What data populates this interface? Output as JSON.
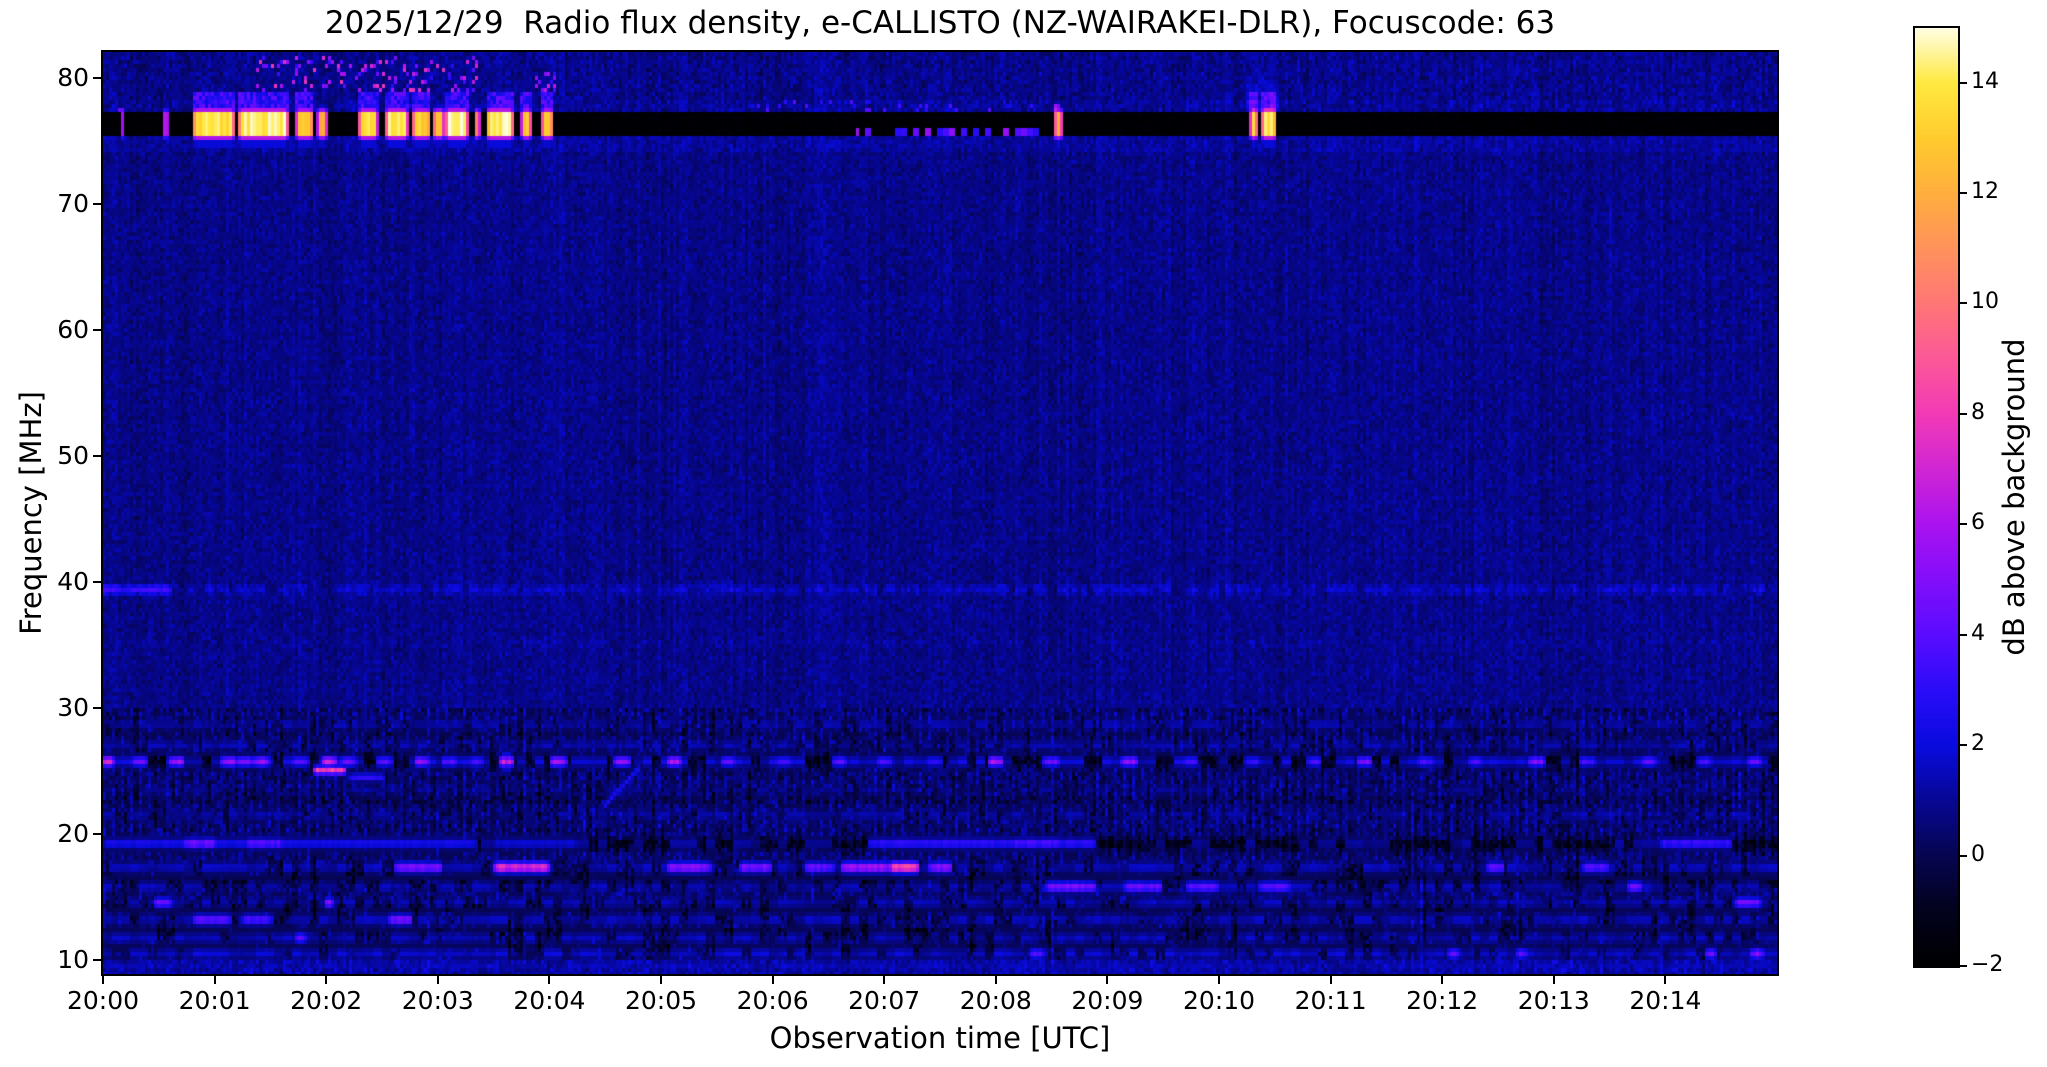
{
  "chart_data": {
    "type": "heatmap",
    "subtype": "radio-spectrogram",
    "title": "2025/12/29  Radio flux density, e-CALLISTO (NZ-WAIRAKEI-DLR), Focuscode: 63",
    "date": "2025/12/29",
    "instrument": "e-CALLISTO (NZ-WAIRAKEI-DLR)",
    "focuscode": "63",
    "xlabel": "Observation time [UTC]",
    "ylabel": "Frequency [MHz]",
    "x_range_minutes": [
      0,
      15
    ],
    "x_start_time": "20:00",
    "y_range_mhz": [
      8.9,
      82.1
    ],
    "grid": false,
    "x_ticks": [
      {
        "t": 0,
        "label": "20:00"
      },
      {
        "t": 1,
        "label": "20:01"
      },
      {
        "t": 2,
        "label": "20:02"
      },
      {
        "t": 3,
        "label": "20:03"
      },
      {
        "t": 4,
        "label": "20:04"
      },
      {
        "t": 5,
        "label": "20:05"
      },
      {
        "t": 6,
        "label": "20:06"
      },
      {
        "t": 7,
        "label": "20:07"
      },
      {
        "t": 8,
        "label": "20:08"
      },
      {
        "t": 9,
        "label": "20:09"
      },
      {
        "t": 10,
        "label": "20:10"
      },
      {
        "t": 11,
        "label": "20:11"
      },
      {
        "t": 12,
        "label": "20:12"
      },
      {
        "t": 13,
        "label": "20:13"
      },
      {
        "t": 14,
        "label": "20:14"
      }
    ],
    "y_ticks": [
      {
        "f": 80,
        "label": "80"
      },
      {
        "f": 70,
        "label": "70"
      },
      {
        "f": 60,
        "label": "60"
      },
      {
        "f": 50,
        "label": "50"
      },
      {
        "f": 40,
        "label": "40"
      },
      {
        "f": 30,
        "label": "30"
      },
      {
        "f": 20,
        "label": "20"
      },
      {
        "f": 10,
        "label": "10"
      }
    ],
    "colorbar": {
      "label": "dB above background",
      "range": [
        -2,
        14.99
      ],
      "ticks": [
        {
          "v": 14,
          "label": "14"
        },
        {
          "v": 12,
          "label": "12"
        },
        {
          "v": 10,
          "label": "10"
        },
        {
          "v": 8,
          "label": "8"
        },
        {
          "v": 6,
          "label": "6"
        },
        {
          "v": 4,
          "label": "4"
        },
        {
          "v": 2,
          "label": "2"
        },
        {
          "v": 0,
          "label": "0"
        },
        {
          "v": -2,
          "label": "−2"
        }
      ]
    },
    "colormap_stops": [
      [
        -2,
        0,
        0,
        0
      ],
      [
        -1,
        2,
        2,
        28
      ],
      [
        0,
        6,
        5,
        80
      ],
      [
        1,
        7,
        7,
        148
      ],
      [
        2,
        9,
        11,
        222
      ],
      [
        3,
        42,
        12,
        248
      ],
      [
        4,
        90,
        12,
        255
      ],
      [
        5,
        130,
        14,
        250
      ],
      [
        6,
        170,
        18,
        240
      ],
      [
        7,
        208,
        38,
        212
      ],
      [
        8,
        242,
        58,
        182
      ],
      [
        9,
        252,
        88,
        152
      ],
      [
        10,
        255,
        118,
        118
      ],
      [
        11,
        255,
        146,
        92
      ],
      [
        12,
        255,
        174,
        62
      ],
      [
        13,
        255,
        203,
        46
      ],
      [
        14,
        255,
        233,
        64
      ],
      [
        15.05,
        255,
        255,
        236
      ]
    ],
    "features": {
      "band": {
        "f0": 75.25,
        "f1": 77.25,
        "value_db": -2
      },
      "band_bursts": [
        [
          0.155,
          0.185,
          9
        ],
        [
          0.54,
          0.585,
          10
        ],
        [
          0.8,
          1.18,
          14.5
        ],
        [
          1.21,
          1.66,
          15
        ],
        [
          1.73,
          1.89,
          14
        ],
        [
          1.92,
          2.01,
          12.5
        ],
        [
          2.29,
          2.46,
          14.5
        ],
        [
          2.53,
          2.73,
          15
        ],
        [
          2.77,
          2.94,
          14
        ],
        [
          2.955,
          3.06,
          13
        ],
        [
          3.07,
          3.27,
          15
        ],
        [
          3.32,
          3.38,
          12
        ],
        [
          3.43,
          3.68,
          15
        ],
        [
          3.75,
          3.84,
          13.5
        ],
        [
          3.93,
          4.04,
          14
        ],
        [
          8.52,
          8.6,
          13
        ],
        [
          10.28,
          10.35,
          14.5
        ],
        [
          10.38,
          10.52,
          15
        ]
      ],
      "band_dashes": [
        [
          6.75,
          6.95,
          0.3
        ],
        [
          7.05,
          8.5,
          0.55
        ]
      ],
      "spikes": [
        [
          0.165,
          77.25,
          77.65,
          6
        ],
        [
          8.556,
          77.25,
          77.95,
          7
        ]
      ],
      "halo": [
        10.25,
        10.55
      ],
      "speckle_clusters": [
        {
          "t0": 1.33,
          "t1": 3.35,
          "f0": 78.8,
          "f1": 81.7,
          "p": 0.16,
          "a0": 2.5,
          "a1": 8,
          "seed": 300
        },
        {
          "t0": 3.88,
          "t1": 4.06,
          "f0": 79.0,
          "f1": 80.4,
          "p": 0.45,
          "a0": 3,
          "a1": 8,
          "seed": 310
        },
        {
          "t0": 5.8,
          "t1": 8.6,
          "f0": 77.35,
          "f1": 78.4,
          "p": 0.12,
          "a0": 1.8,
          "a1": 4,
          "seed": 320
        }
      ],
      "line_39mhz": {
        "f": 39.4,
        "amp": 0.6,
        "bright_segment": [
          0,
          0.62,
          1.6
        ]
      },
      "line_35mhz": {
        "f": 35.2,
        "amp": 0.45,
        "p": 0.3
      },
      "dark_lanes": [
        [
          25.8,
          0.55,
          -1.35
        ],
        [
          19.2,
          0.5,
          -1.5
        ],
        [
          16.5,
          0.4,
          -1.0
        ],
        [
          14.0,
          0.33,
          -0.85
        ],
        [
          12.35,
          0.3,
          -0.8
        ],
        [
          11.1,
          0.28,
          -0.75
        ],
        [
          28.0,
          0.3,
          -0.4
        ],
        [
          22.7,
          0.35,
          -0.4
        ]
      ],
      "rfi_lines": [
        {
          "f": 28.7,
          "hw": 0.35,
          "p": 0.5,
          "amp": 1.7,
          "seed": 11
        },
        {
          "f": 27.05,
          "hw": 0.33,
          "p": 0.5,
          "amp": 1.7,
          "seed": 12
        },
        {
          "f": 25.75,
          "hw": 0.38,
          "p": 0.62,
          "amp": 2.4,
          "seed": 13,
          "hot": [
            [
              0.03,
              8
            ],
            [
              0.33,
              5
            ],
            [
              0.66,
              6.5
            ],
            [
              1.13,
              6
            ],
            [
              1.27,
              5.5
            ],
            [
              1.42,
              6
            ],
            [
              1.77,
              4.5
            ],
            [
              2.03,
              7.5
            ],
            [
              2.2,
              5
            ],
            [
              2.52,
              4.5
            ],
            [
              2.86,
              6
            ],
            [
              3.1,
              4.5
            ],
            [
              3.35,
              4
            ],
            [
              3.62,
              7.5
            ],
            [
              4.08,
              6.5
            ],
            [
              4.65,
              6
            ],
            [
              5.12,
              6.5
            ],
            [
              5.6,
              4.5
            ],
            [
              6.1,
              4
            ],
            [
              6.6,
              4.5
            ],
            [
              7.0,
              4
            ],
            [
              7.45,
              3.5
            ],
            [
              8.0,
              6.5
            ],
            [
              8.5,
              5
            ],
            [
              9.2,
              6
            ],
            [
              9.75,
              4
            ],
            [
              10.3,
              3.5
            ],
            [
              10.85,
              4
            ],
            [
              11.3,
              5.5
            ],
            [
              11.85,
              4
            ],
            [
              12.3,
              4
            ],
            [
              12.85,
              5.5
            ],
            [
              13.3,
              4
            ],
            [
              13.85,
              4.5
            ],
            [
              14.35,
              4
            ],
            [
              14.8,
              5
            ]
          ]
        },
        {
          "f": 25.05,
          "hw": 0.3,
          "p": 0,
          "amp": 0,
          "seed": 24,
          "segments": [
            [
              1.88,
              2.18,
              9
            ]
          ]
        },
        {
          "f": 24.5,
          "hw": 0.3,
          "p": 0,
          "amp": 0,
          "seed": 25,
          "segments": [
            [
              2.2,
              2.52,
              3.4
            ]
          ]
        },
        {
          "f": 23.5,
          "hw": 0.3,
          "p": 0.3,
          "amp": 1.2,
          "seed": 14
        },
        {
          "f": 21.5,
          "hw": 0.35,
          "p": 0.45,
          "amp": 1.6,
          "seed": 15
        },
        {
          "f": 19.25,
          "hw": 0.38,
          "p": 0.4,
          "amp": 1.5,
          "seed": 16,
          "segments": [
            [
              0,
              3.35,
              2.8
            ],
            [
              0.72,
              1.02,
              5.2
            ],
            [
              1.28,
              1.62,
              4.6
            ],
            [
              3.5,
              4.25,
              2.2
            ],
            [
              6.85,
              8.9,
              3.5
            ],
            [
              8.15,
              8.6,
              4.2
            ],
            [
              13.95,
              14.6,
              3.8
            ]
          ]
        },
        {
          "f": 17.35,
          "hw": 0.4,
          "p": 0.55,
          "amp": 2.0,
          "seed": 17,
          "segments": [
            [
              2.6,
              3.05,
              5.5
            ],
            [
              3.5,
              4.0,
              8.5
            ],
            [
              5.05,
              5.45,
              6
            ],
            [
              5.7,
              6.0,
              5.5
            ],
            [
              6.28,
              6.55,
              5
            ],
            [
              6.6,
              7.05,
              6.5
            ],
            [
              7.05,
              7.32,
              10
            ],
            [
              7.4,
              7.62,
              6
            ],
            [
              12.4,
              12.56,
              5
            ],
            [
              13.25,
              13.5,
              4.5
            ]
          ]
        },
        {
          "f": 15.8,
          "hw": 0.4,
          "p": 0.5,
          "amp": 1.8,
          "seed": 18,
          "segments": [
            [
              8.45,
              8.9,
              5.5
            ],
            [
              9.15,
              9.5,
              5
            ],
            [
              9.7,
              10.0,
              4.5
            ],
            [
              10.35,
              10.65,
              4.5
            ],
            [
              13.65,
              13.8,
              5
            ]
          ]
        },
        {
          "f": 14.55,
          "hw": 0.38,
          "p": 0.5,
          "amp": 1.8,
          "seed": 19,
          "segments": [
            [
              0.45,
              0.62,
              5
            ],
            [
              1.98,
              2.06,
              6
            ],
            [
              14.62,
              14.86,
              5
            ]
          ]
        },
        {
          "f": 13.2,
          "hw": 0.4,
          "p": 0.55,
          "amp": 2.0,
          "seed": 20,
          "segments": [
            [
              0.8,
              1.15,
              4.8
            ],
            [
              1.25,
              1.52,
              4.2
            ],
            [
              2.56,
              2.78,
              5.5
            ]
          ]
        },
        {
          "f": 11.75,
          "hw": 0.4,
          "p": 0.55,
          "amp": 1.9,
          "seed": 21,
          "segments": [
            [
              1.72,
              1.82,
              5
            ]
          ]
        },
        {
          "f": 10.5,
          "hw": 0.4,
          "p": 0.7,
          "amp": 2.2,
          "seed": 22,
          "segments": [
            [
              8.3,
              8.44,
              4.5
            ],
            [
              12.05,
              12.16,
              4.5
            ],
            [
              12.65,
              12.78,
              4.5
            ],
            [
              14.35,
              14.46,
              5
            ],
            [
              14.75,
              14.88,
              5.5
            ]
          ]
        },
        {
          "f": 9.55,
          "hw": 0.45,
          "p": 0.8,
          "amp": 1.7,
          "seed": 23
        }
      ],
      "diagonal": {
        "t0": 4.5,
        "t1": 4.82,
        "f0": 22.3,
        "f1": 25.4,
        "amp": 2.6
      },
      "cross": {
        "t0": 3.575,
        "t1": 3.665,
        "f": 25.75,
        "hh": 1.3,
        "amp": 3.4
      }
    }
  }
}
